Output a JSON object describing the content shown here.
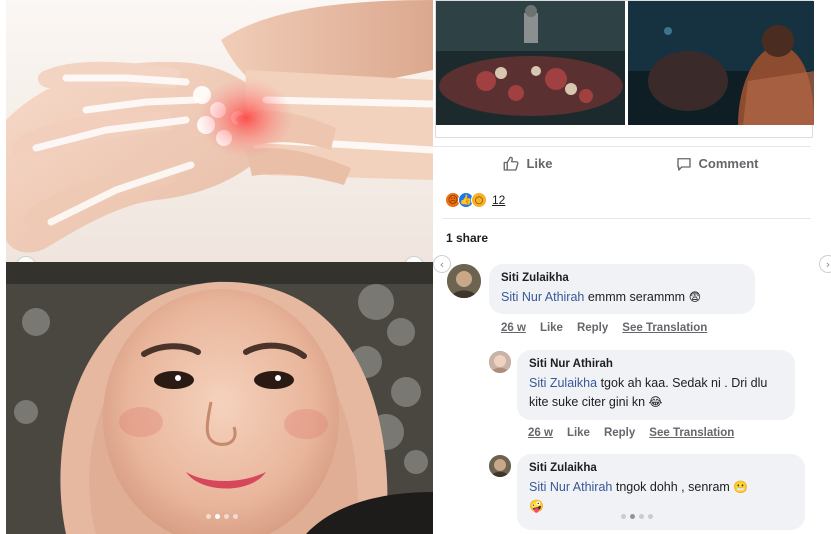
{
  "post": {
    "actions": {
      "like_label": "Like",
      "comment_label": "Comment"
    },
    "reactions": {
      "icons": [
        "angry-icon",
        "like-icon",
        "wow-icon"
      ],
      "count": "12"
    },
    "share_count": "1 share"
  },
  "comments": [
    {
      "author": "Siti Zulaikha",
      "tag": "Siti Nur Athirah",
      "text": " emmm serammm",
      "emoji": "😨",
      "time": "26 w",
      "like": "Like",
      "reply": "Reply",
      "translate": "See Translation"
    },
    {
      "author": "Siti Nur Athirah",
      "tag": "Siti Zulaikha",
      "text": " tgok ah kaa. Sedak ni . Dri dlu kite suke citer gini kn",
      "emoji": "😂",
      "time": "26 w",
      "like": "Like",
      "reply": "Reply",
      "translate": "See Translation"
    },
    {
      "author": "Siti Zulaikha",
      "tag": "Siti Nur Athirah",
      "text": " tngok dohh , senram",
      "emoji": "😬",
      "emoji2": "🤪"
    }
  ],
  "colors": {
    "tag": "#385898",
    "bubble": "#f0f2f5",
    "meta": "#65676b"
  }
}
